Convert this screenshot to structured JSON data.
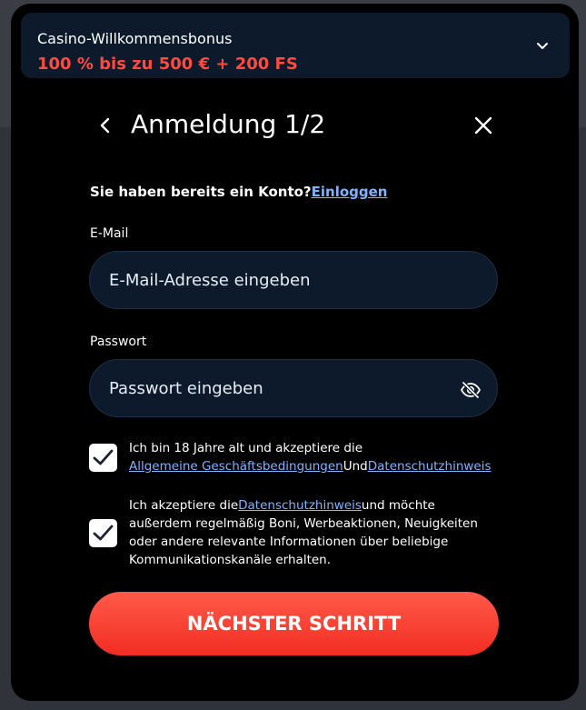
{
  "bonus": {
    "label": "Casino-Willkommensbonus",
    "value": "100 % bis zu 500 € + 200 FS",
    "chevron_icon": "chevron-down-icon"
  },
  "header": {
    "title": "Anmeldung 1/2",
    "back_icon": "chevron-left-icon",
    "close_icon": "close-icon"
  },
  "account": {
    "prompt": "Sie haben bereits ein Konto?",
    "login_link": "Einloggen"
  },
  "email": {
    "label": "E-Mail",
    "placeholder": "E-Mail-Adresse eingeben",
    "value": ""
  },
  "password": {
    "label": "Passwort",
    "placeholder": "Passwort eingeben",
    "value": "",
    "visibility_icon": "eye-off-icon"
  },
  "consents": [
    {
      "checked": true,
      "text_before": "Ich bin 18 Jahre alt und akzeptiere die ",
      "link1": "Allgemeine Geschäftsbedingungen",
      "middle": "Und",
      "link2": "Datenschutzhinweis"
    },
    {
      "checked": true,
      "text_before": "Ich akzeptiere die",
      "link1": "Datenschutzhinweis",
      "text_after": "und möchte außerdem regelmäßig Boni, Werbeaktionen, Neuigkeiten oder andere relevante Informationen über beliebige Kommunikationskanäle erhalten."
    }
  ],
  "submit": {
    "label": "NÄCHSTER SCHRITT"
  },
  "colors": {
    "accent": "#ff4a3d",
    "link": "#7fb2ff",
    "input_bg": "#0c1a2c"
  }
}
